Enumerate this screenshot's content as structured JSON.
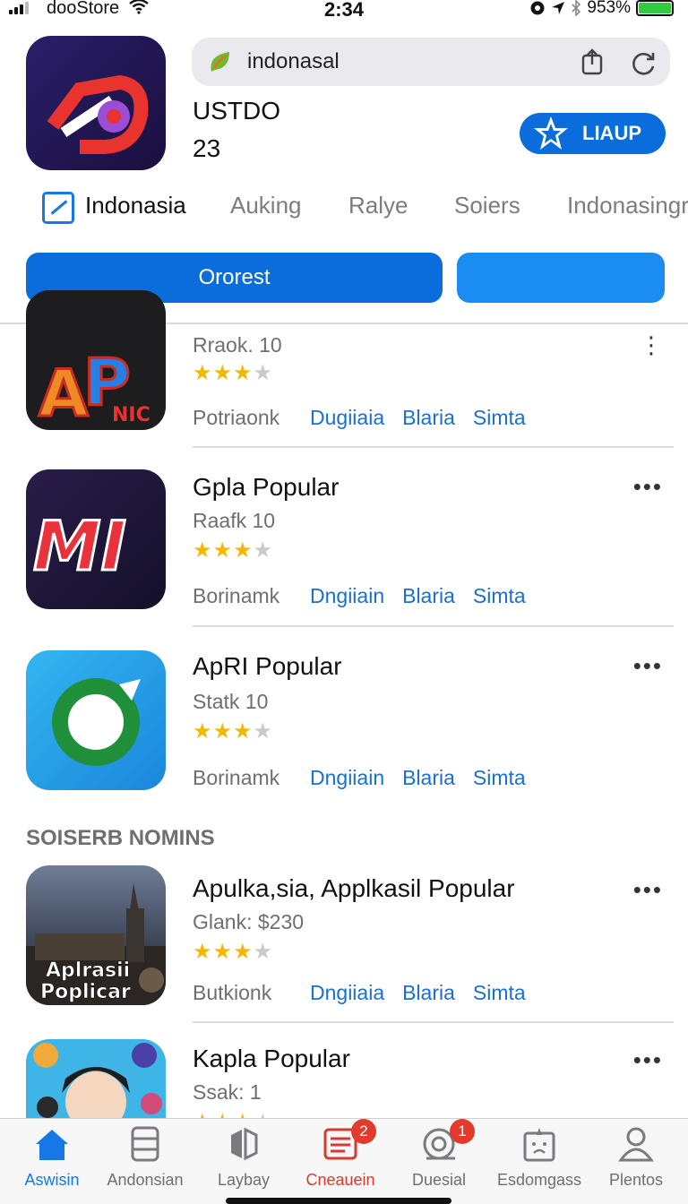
{
  "status_bar": {
    "carrier": "dooStore",
    "time": "2:34",
    "battery": "953%"
  },
  "header": {
    "search_query": "indonasal",
    "app_title": "USTDO",
    "app_subtitle": "23",
    "get_button": "LIAUP"
  },
  "tabs": [
    "Indonasia",
    "Auking",
    "Ralye",
    "Soiers",
    "Indonasingr"
  ],
  "segmented": {
    "primary": "Ororest",
    "secondary": ""
  },
  "section_heading": "SOISERB NOMINS",
  "rows": [
    {
      "name": "",
      "meta": "Rraok. 10",
      "rating": 3,
      "tagline": [
        "Potriaonk",
        "Dugiiaia",
        "Blaria",
        "Simta"
      ]
    },
    {
      "name": "Gpla Popular",
      "meta": "Raafk  10",
      "rating": 3,
      "tagline": [
        "Borinamk",
        "Dngiiain",
        "Blaria",
        "Simta"
      ]
    },
    {
      "name": "ApRI Popular",
      "meta": "Statk  10",
      "rating": 3,
      "tagline": [
        "Borinamk",
        "Dngiiain",
        "Blaria",
        "Simta"
      ]
    },
    {
      "name": "Apulka,sia, Applkasil Popular",
      "meta": "Glank: $230",
      "rating": 3,
      "tagline": [
        "Butkionk",
        "Dngiiaia",
        "Blaria",
        "Simta"
      ],
      "icon_caption": "Aplrasii Poplicar"
    },
    {
      "name": "Kapla Popular",
      "meta": "Ssak:  1",
      "rating": 3,
      "tagline": []
    }
  ],
  "tab_bar": [
    {
      "label": "Aswisin",
      "icon": "home-icon",
      "badge": ""
    },
    {
      "label": "Andonsian",
      "icon": "apps-icon",
      "badge": ""
    },
    {
      "label": "Laybay",
      "icon": "games-icon",
      "badge": ""
    },
    {
      "label": "Cneauein",
      "icon": "updates-icon",
      "badge": "2"
    },
    {
      "label": "Duesial",
      "icon": "search-icon",
      "badge": "1"
    },
    {
      "label": "Esdomgass",
      "icon": "arcade-icon",
      "badge": ""
    },
    {
      "label": "Plentos",
      "icon": "profile-icon",
      "badge": ""
    }
  ],
  "colors": {
    "accent": "#0a6ddb",
    "link": "#1a6fd1",
    "star": "#f5b800",
    "badge": "#e23a2b"
  }
}
